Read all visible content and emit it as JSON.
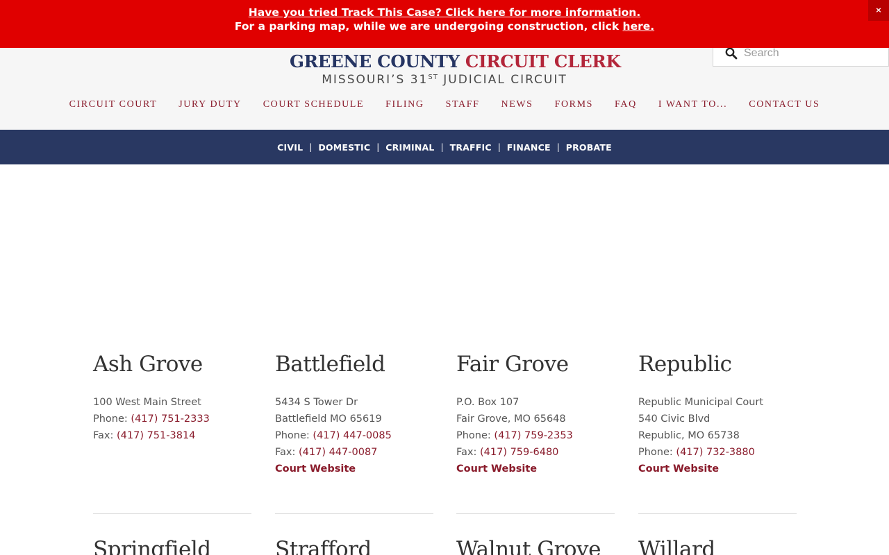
{
  "alert": {
    "line1_link": "Have you tried Track This Case? Click here for more information. ",
    "line2_text": "For a parking map, while we are undergoing construction, click ",
    "line2_link": "here.",
    "close": "×"
  },
  "header": {
    "logo": {
      "stars": "★★★",
      "title_part1": "GREENE COUNTY",
      "title_part2": "CIRCUIT CLERK",
      "sub_part1": "MISSOURI’S 31",
      "sub_sup": "ST",
      "sub_part2": "JUDICIAL CIRCUIT"
    },
    "search": {
      "placeholder": "Search"
    },
    "nav": [
      "CIRCUIT COURT",
      "JURY DUTY",
      "COURT SCHEDULE",
      "FILING",
      "STAFF",
      "NEWS",
      "FORMS",
      "FAQ",
      "I WANT TO...",
      "CONTACT US"
    ]
  },
  "subnav": [
    "CIVIL",
    "DOMESTIC",
    "CRIMINAL",
    "TRAFFIC",
    "FINANCE",
    "PROBATE"
  ],
  "subnav_sep": "|",
  "courts": [
    {
      "name": "Ash Grove",
      "address": [
        "100 West Main Street"
      ],
      "phone_label": "Phone: ",
      "phone": "(417) 751-2333",
      "fax_label": "Fax: ",
      "fax": "(417) 751-3814"
    },
    {
      "name": "Battlefield",
      "address": [
        "5434 S Tower Dr",
        "Battlefield MO 65619"
      ],
      "phone_label": "Phone: ",
      "phone": "(417) 447-0085",
      "fax_label": "Fax: ",
      "fax": "(417) 447-0087",
      "website": "Court Website"
    },
    {
      "name": "Fair Grove",
      "address": [
        "P.O. Box 107",
        "Fair Grove, MO 65648"
      ],
      "phone_label": "Phone: ",
      "phone": "(417) 759-2353",
      "fax_label": "Fax: ",
      "fax": "(417) 759-6480",
      "website": "Court Website"
    },
    {
      "name": "Republic",
      "address": [
        "Republic Municipal Court",
        "540 Civic Blvd",
        "Republic, MO 65738"
      ],
      "phone_label": "Phone: ",
      "phone": "(417) 732-3880",
      "website": "Court Website"
    }
  ],
  "courts_row2": [
    "Springfield",
    "Strafford",
    "Walnut Grove",
    "Willard"
  ],
  "colors": {
    "alert_red": "#e00000",
    "navy": "#293862",
    "brand_red": "#b3263a",
    "link_maroon": "#8a1c2c"
  }
}
